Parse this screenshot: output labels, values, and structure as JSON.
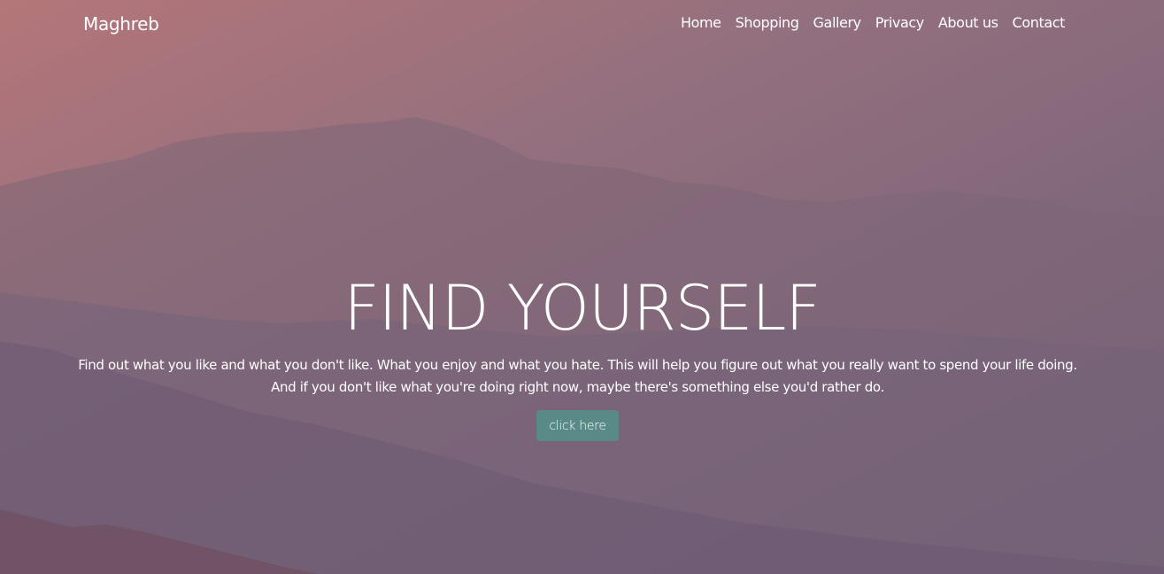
{
  "navbar": {
    "brand": "Maghreb",
    "links": [
      {
        "label": "Home"
      },
      {
        "label": "Shopping"
      },
      {
        "label": "Gallery"
      },
      {
        "label": "Privacy"
      },
      {
        "label": "About us"
      },
      {
        "label": "Contact"
      }
    ]
  },
  "hero": {
    "title": "FIND YOURSELF",
    "text_line1": "Find out what you like and what you don't like. What you enjoy and what you hate. This will help you figure out what you really want to spend your life doing.",
    "text_line2": "And if you don't like what you're doing right now, maybe there's something else you'd rather do.",
    "button_label": "click here"
  },
  "colors": {
    "button_bg": "#5a8a88",
    "text": "#ffffff",
    "sky_top": "#b0767a",
    "sky_bottom": "#6e5f78"
  }
}
